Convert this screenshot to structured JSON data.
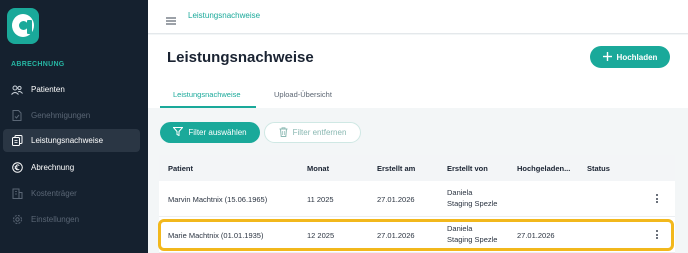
{
  "sidebar": {
    "section_label": "ABRECHNUNG",
    "items": [
      {
        "label": "Patienten",
        "icon": "patients-icon",
        "state": "normal"
      },
      {
        "label": "Genehmigungen",
        "icon": "document-check-icon",
        "state": "disabled"
      },
      {
        "label": "Leistungsnachweise",
        "icon": "documents-icon",
        "state": "active"
      },
      {
        "label": "Abrechnung",
        "icon": "euro-icon",
        "state": "normal"
      },
      {
        "label": "Kostenträger",
        "icon": "building-icon",
        "state": "disabled"
      },
      {
        "label": "Einstellungen",
        "icon": "gear-icon",
        "state": "disabled"
      }
    ]
  },
  "topbar": {
    "breadcrumb": "Leistungsnachweise"
  },
  "main": {
    "title": "Leistungsnachweise",
    "upload_label": "Hochladen",
    "tabs": [
      {
        "label": "Leistungsnachweise",
        "active": true
      },
      {
        "label": "Upload-Übersicht",
        "active": false
      }
    ],
    "filter_select_label": "Filter auswählen",
    "filter_remove_label": "Filter entfernen"
  },
  "table": {
    "columns": [
      "Patient",
      "Monat",
      "Erstellt am",
      "Erstellt von",
      "Hochgeladen...",
      "Status"
    ],
    "rows": [
      {
        "patient": "Marvin Machtnix (15.06.1965)",
        "monat": "11 2025",
        "erstellt_am": "27.01.2026",
        "erstellt_von_1": "Daniela",
        "erstellt_von_2": "Staging Spezle",
        "hochgeladen": "",
        "status": ""
      },
      {
        "patient": "Marie Machtnix (01.01.1935)",
        "monat": "12 2025",
        "erstellt_am": "27.01.2026",
        "erstellt_von_1": "Daniela",
        "erstellt_von_2": "Staging Spezle",
        "hochgeladen": "27.01.2026",
        "status": ""
      }
    ]
  },
  "colors": {
    "accent": "#1aa99a",
    "sidebar_bg": "#15212f",
    "highlight": "#f2b81c"
  }
}
